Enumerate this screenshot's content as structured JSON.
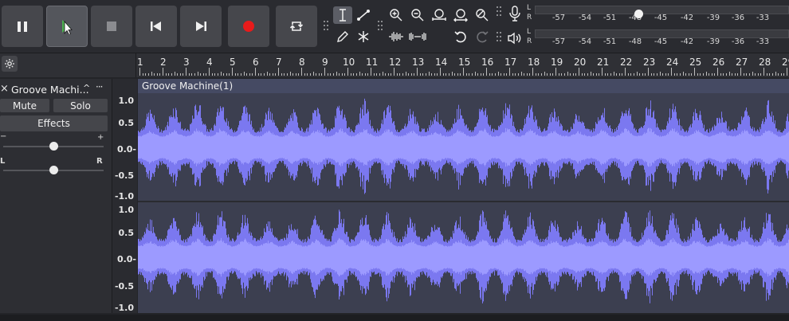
{
  "toolbar": {
    "transport": [
      "pause-button",
      "play-button",
      "stop-button",
      "skip-start-button",
      "skip-end-button",
      "record-button",
      "loop-button"
    ],
    "meters": {
      "record": {
        "l_label": "L",
        "r_label": "R",
        "ticks": [
          "-57",
          "-54",
          "-51",
          "-48",
          "-45",
          "-42",
          "-39",
          "-36",
          "-33"
        ]
      },
      "playback": {
        "l_label": "L",
        "r_label": "R",
        "ticks": [
          "-57",
          "-54",
          "-51",
          "-48",
          "-45",
          "-42",
          "-39",
          "-36",
          "-33"
        ]
      }
    }
  },
  "ruler": {
    "numbers": [
      "1",
      "2",
      "3",
      "4",
      "5",
      "6",
      "7",
      "8",
      "9",
      "10",
      "11",
      "12",
      "13",
      "14",
      "15",
      "16",
      "17",
      "18",
      "19",
      "20",
      "21",
      "22",
      "23",
      "24",
      "25",
      "26",
      "27",
      "28",
      "29"
    ]
  },
  "track": {
    "name": "Groove Machi...",
    "close_glyph": "×",
    "collapse_glyph": "^",
    "menu_glyph": "···",
    "mute_label": "Mute",
    "solo_label": "Solo",
    "effects_label": "Effects",
    "gain_minus": "−",
    "gain_plus": "+",
    "pan_left": "L",
    "pan_right": "R",
    "gain_level": 0.5,
    "pan_level": 0.5
  },
  "clip": {
    "title": "Groove Machine(1)"
  },
  "vertical_scale": {
    "channel1": [
      "1.0",
      "0.5",
      "0.0-",
      "-0.5",
      "-1.0"
    ],
    "channel2": [
      "1.0",
      "0.5",
      "0.0-",
      "-0.5",
      "-1.0"
    ]
  },
  "colors": {
    "waveform": "#7b78f0",
    "waveform_rms": "#9c9aff",
    "record": "#e81b1b",
    "clip_bg": "#3c3f50",
    "clip_title": "#454a63"
  }
}
